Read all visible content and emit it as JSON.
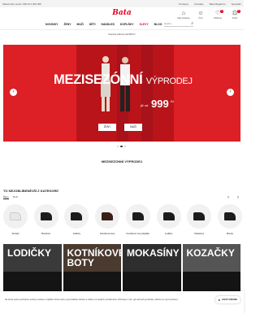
{
  "topbar": {
    "contact": "Zákaznický servis: 800 971 000 000",
    "links": [
      "Prodejny",
      "Kontakty",
      "Bata Magazine",
      "Speciální"
    ]
  },
  "header": {
    "logo": "Bata",
    "icons": [
      {
        "name": "store-icon",
        "glyph": "⌂",
        "label": "Najít prodejnu"
      },
      {
        "name": "user-icon",
        "glyph": "☺",
        "label": "Účet"
      },
      {
        "name": "heart-icon",
        "glyph": "♡",
        "label": "Oblíbené",
        "badge": "0"
      },
      {
        "name": "cart-icon",
        "glyph": "⊡",
        "label": "Košík",
        "badge": "0"
      }
    ]
  },
  "nav": {
    "items": [
      "NOVINKY",
      "ŽENY",
      "MUŽI",
      "DĚTI",
      "HANDLES",
      "DOPLŇKY",
      "SLEVY",
      "BLOG"
    ],
    "search_placeholder": "Hledat"
  },
  "promo_line": "Doprava zdarma nad 999 Kč",
  "hero": {
    "headline_bold": "MEZISEZÓNNÍ",
    "headline_thin": "VÝPRODEJ",
    "price_from": "již od",
    "price": "999",
    "currency": "Kč",
    "cta_women": "ŽENY",
    "cta_men": "MUŽI",
    "prev": "‹",
    "next": "›"
  },
  "carousel": {
    "slides": 3,
    "active": 1
  },
  "caption": "MEZISEZÓNNÍ VÝPRODEJ",
  "categories": {
    "title": "TO NEJOBLÍBENĚJŠÍ Z KATEGORIÍ",
    "tabs": [
      "Ženy",
      "Muži"
    ],
    "prev": "‹",
    "next": "›",
    "items": [
      {
        "label": "Tenisky",
        "tone": "white"
      },
      {
        "label": "Barefoot",
        "tone": "dark"
      },
      {
        "label": "Holinky",
        "tone": "dark"
      },
      {
        "label": "Kotníkové boty",
        "tone": "brown"
      },
      {
        "label": "Kotníkové na podpatku",
        "tone": "dark"
      },
      {
        "label": "Lodičky",
        "tone": "dark"
      },
      {
        "label": "Mokasíny",
        "tone": "dark"
      },
      {
        "label": "Bundy",
        "tone": "dark"
      }
    ]
  },
  "tiles": [
    "LODIČKY",
    "KOTNÍKOVÉ BOTY",
    "MOKASÍNY",
    "KOZAČKY"
  ],
  "cookie_text": "Na tomto webu používáme soubory cookies k zajištění funkcí webu, personalizaci obsahu a reklam a k analýze návštěvnosti. Informace o tom, jak náš web používáte, sdílíme se svými partnery.",
  "chat": {
    "icon": "chat-icon",
    "label": "CHAT ONLINE"
  }
}
